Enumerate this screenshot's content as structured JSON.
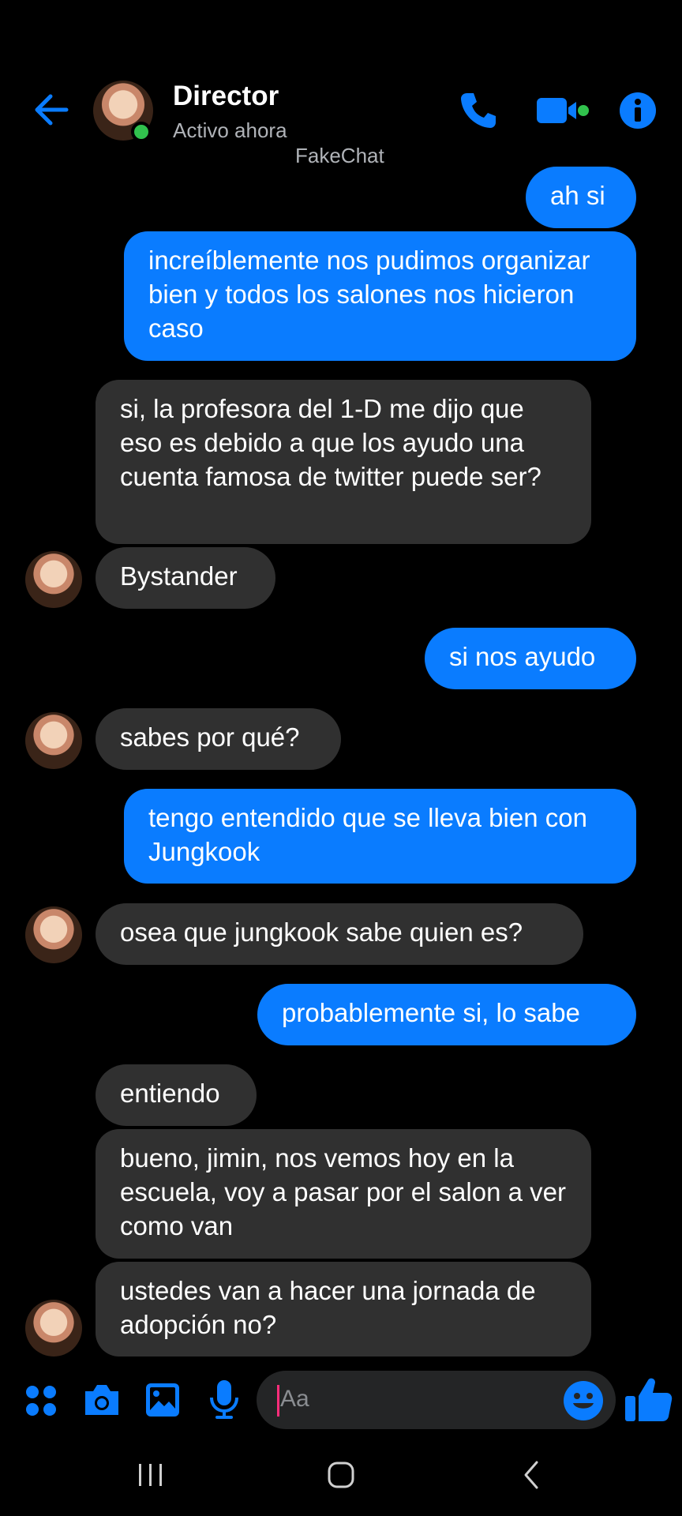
{
  "header": {
    "contact_name": "Director",
    "status": "Activo ahora",
    "watermark": "FakeChat"
  },
  "messages": [
    {
      "dir": "out",
      "text": "ah si"
    },
    {
      "dir": "out",
      "text": "increíblemente nos pudimos organizar bien y todos los salones nos hicieron caso"
    },
    {
      "dir": "in",
      "text": "si, la profesora del 1-D me dijo que eso es debido a que los ayudo una cuenta famosa de twitter puede ser?"
    },
    {
      "dir": "in",
      "text": "Bystander"
    },
    {
      "dir": "out",
      "text": "si nos ayudo"
    },
    {
      "dir": "in",
      "text": "sabes por qué?"
    },
    {
      "dir": "out",
      "text": "tengo entendido que se lleva bien con Jungkook"
    },
    {
      "dir": "in",
      "text": "osea que jungkook sabe quien es?"
    },
    {
      "dir": "out",
      "text": "probablemente si, lo sabe"
    },
    {
      "dir": "in",
      "text": "entiendo"
    },
    {
      "dir": "in",
      "text": "bueno, jimin, nos vemos hoy en la escuela, voy a pasar por el salon a ver como van"
    },
    {
      "dir": "in",
      "text": "ustedes van a hacer una jornada de adopción no?"
    }
  ],
  "composer": {
    "placeholder": "Aa"
  },
  "colors": {
    "accent": "#0a7cff",
    "incoming_bubble": "#303030",
    "online": "#31c24d",
    "background": "#000000"
  },
  "icons": [
    "back-arrow-icon",
    "phone-icon",
    "video-camera-icon",
    "info-icon",
    "apps-icon",
    "camera-icon",
    "gallery-icon",
    "microphone-icon",
    "emoji-icon",
    "thumbs-up-icon"
  ]
}
